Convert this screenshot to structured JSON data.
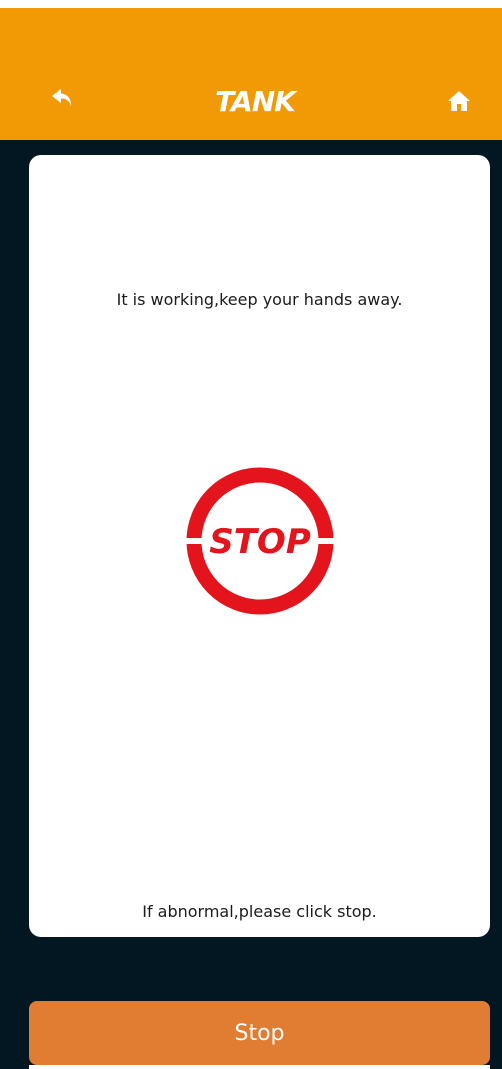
{
  "header": {
    "logo_text": "TANK",
    "back_icon": "back-arrow-icon",
    "home_icon": "home-icon",
    "background_color": "#f29a06"
  },
  "card": {
    "message": "It is working,keep your hands away.",
    "stop_sign_text": "STOP",
    "stop_sign_color": "#e3141b",
    "hint": "If abnormal,please click stop."
  },
  "footer": {
    "stop_button_label": "Stop",
    "button_color": "#e07d32"
  }
}
